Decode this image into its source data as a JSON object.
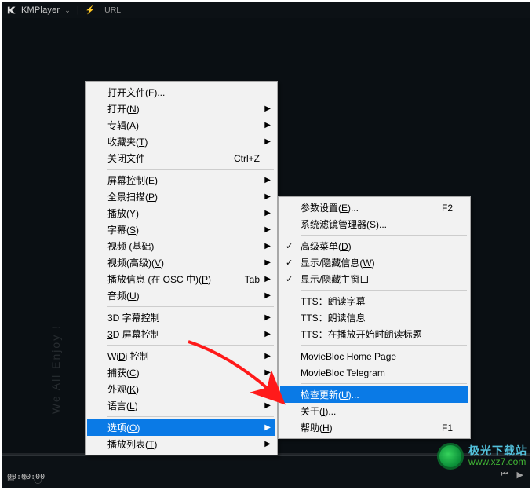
{
  "title_bar": {
    "app_name": "KMPlayer",
    "url_label": "URL"
  },
  "vertical_tag": "We All Enjoy !",
  "time": "00:00:00",
  "menu1": [
    {
      "type": "item",
      "label": "打开文件(<u>F</u>)...",
      "name": "open-file"
    },
    {
      "type": "item",
      "label": "打开(<u>N</u>)",
      "name": "open",
      "arrow": true
    },
    {
      "type": "item",
      "label": "专辑(<u>A</u>)",
      "name": "album",
      "arrow": true
    },
    {
      "type": "item",
      "label": "收藏夹(<u>T</u>)",
      "name": "favorites",
      "arrow": true
    },
    {
      "type": "item",
      "label": "关闭文件",
      "name": "close-file",
      "shortcut": "Ctrl+Z"
    },
    {
      "type": "sep"
    },
    {
      "type": "item",
      "label": "屏幕控制(<u>E</u>)",
      "name": "screen-control",
      "arrow": true
    },
    {
      "type": "item",
      "label": "全景扫描(<u>P</u>)",
      "name": "pan-scan",
      "arrow": true
    },
    {
      "type": "item",
      "label": "播放(<u>Y</u>)",
      "name": "playback",
      "arrow": true
    },
    {
      "type": "item",
      "label": "字幕(<u>S</u>)",
      "name": "subtitle",
      "arrow": true
    },
    {
      "type": "item",
      "label": "视频 (基础)",
      "name": "video-basic",
      "arrow": true
    },
    {
      "type": "item",
      "label": "视频(高级)(<u>V</u>)",
      "name": "video-advanced",
      "arrow": true
    },
    {
      "type": "item",
      "label": "播放信息 (在 OSC 中)(<u>P</u>)",
      "name": "play-info-osc",
      "shortcut": "Tab",
      "arrow": true
    },
    {
      "type": "item",
      "label": "音频(<u>U</u>)",
      "name": "audio",
      "arrow": true
    },
    {
      "type": "sep"
    },
    {
      "type": "item",
      "label": "3D 字幕控制",
      "name": "3d-subtitle",
      "arrow": true
    },
    {
      "type": "item",
      "label": "<u>3</u>D 屏幕控制",
      "name": "3d-screen",
      "arrow": true
    },
    {
      "type": "sep"
    },
    {
      "type": "item",
      "label": "Wi<u>D</u>i 控制",
      "name": "widi",
      "arrow": true
    },
    {
      "type": "item",
      "label": "捕获(<u>C</u>)",
      "name": "capture",
      "arrow": true
    },
    {
      "type": "item",
      "label": "外观(<u>K</u>)",
      "name": "skin",
      "arrow": true
    },
    {
      "type": "item",
      "label": "语言(<u>L</u>)",
      "name": "language",
      "arrow": true
    },
    {
      "type": "sep"
    },
    {
      "type": "item",
      "label": "选项(<u>O</u>)",
      "name": "options",
      "arrow": true,
      "highlight": true
    },
    {
      "type": "item",
      "label": "播放列表(<u>T</u>)",
      "name": "playlist",
      "arrow": true
    }
  ],
  "menu2": [
    {
      "type": "item",
      "label": "参数设置(<u>E</u>)...",
      "name": "preferences",
      "shortcut": "F2"
    },
    {
      "type": "item",
      "label": "系统滤镜管理器(<u>S</u>)...",
      "name": "filter-manager"
    },
    {
      "type": "sep"
    },
    {
      "type": "item",
      "label": "高级菜单(<u>D</u>)",
      "name": "advanced-menu",
      "check": true
    },
    {
      "type": "item",
      "label": "显示/隐藏信息(<u>W</u>)",
      "name": "toggle-info",
      "check": true
    },
    {
      "type": "item",
      "label": "显示/隐藏主窗口",
      "name": "toggle-mainwin",
      "check": true
    },
    {
      "type": "sep"
    },
    {
      "type": "item",
      "label": "TTS：朗读字幕",
      "name": "tts-sub"
    },
    {
      "type": "item",
      "label": "TTS：朗读信息",
      "name": "tts-info"
    },
    {
      "type": "item",
      "label": "TTS：在播放开始时朗读标题",
      "name": "tts-title"
    },
    {
      "type": "sep"
    },
    {
      "type": "item",
      "label": "MovieBloc Home Page",
      "name": "moviebloc-home"
    },
    {
      "type": "item",
      "label": "MovieBloc Telegram",
      "name": "moviebloc-telegram"
    },
    {
      "type": "sep"
    },
    {
      "type": "item",
      "label": "检查更新(<u>U</u>)...",
      "name": "check-updates",
      "highlight": true
    },
    {
      "type": "item",
      "label": "关于(<u>I</u>)...",
      "name": "about"
    },
    {
      "type": "item",
      "label": "帮助(<u>H</u>)",
      "name": "help",
      "shortcut": "F1"
    }
  ],
  "watermark": {
    "cn": "极光下载站",
    "url": "www.xz7.com"
  }
}
